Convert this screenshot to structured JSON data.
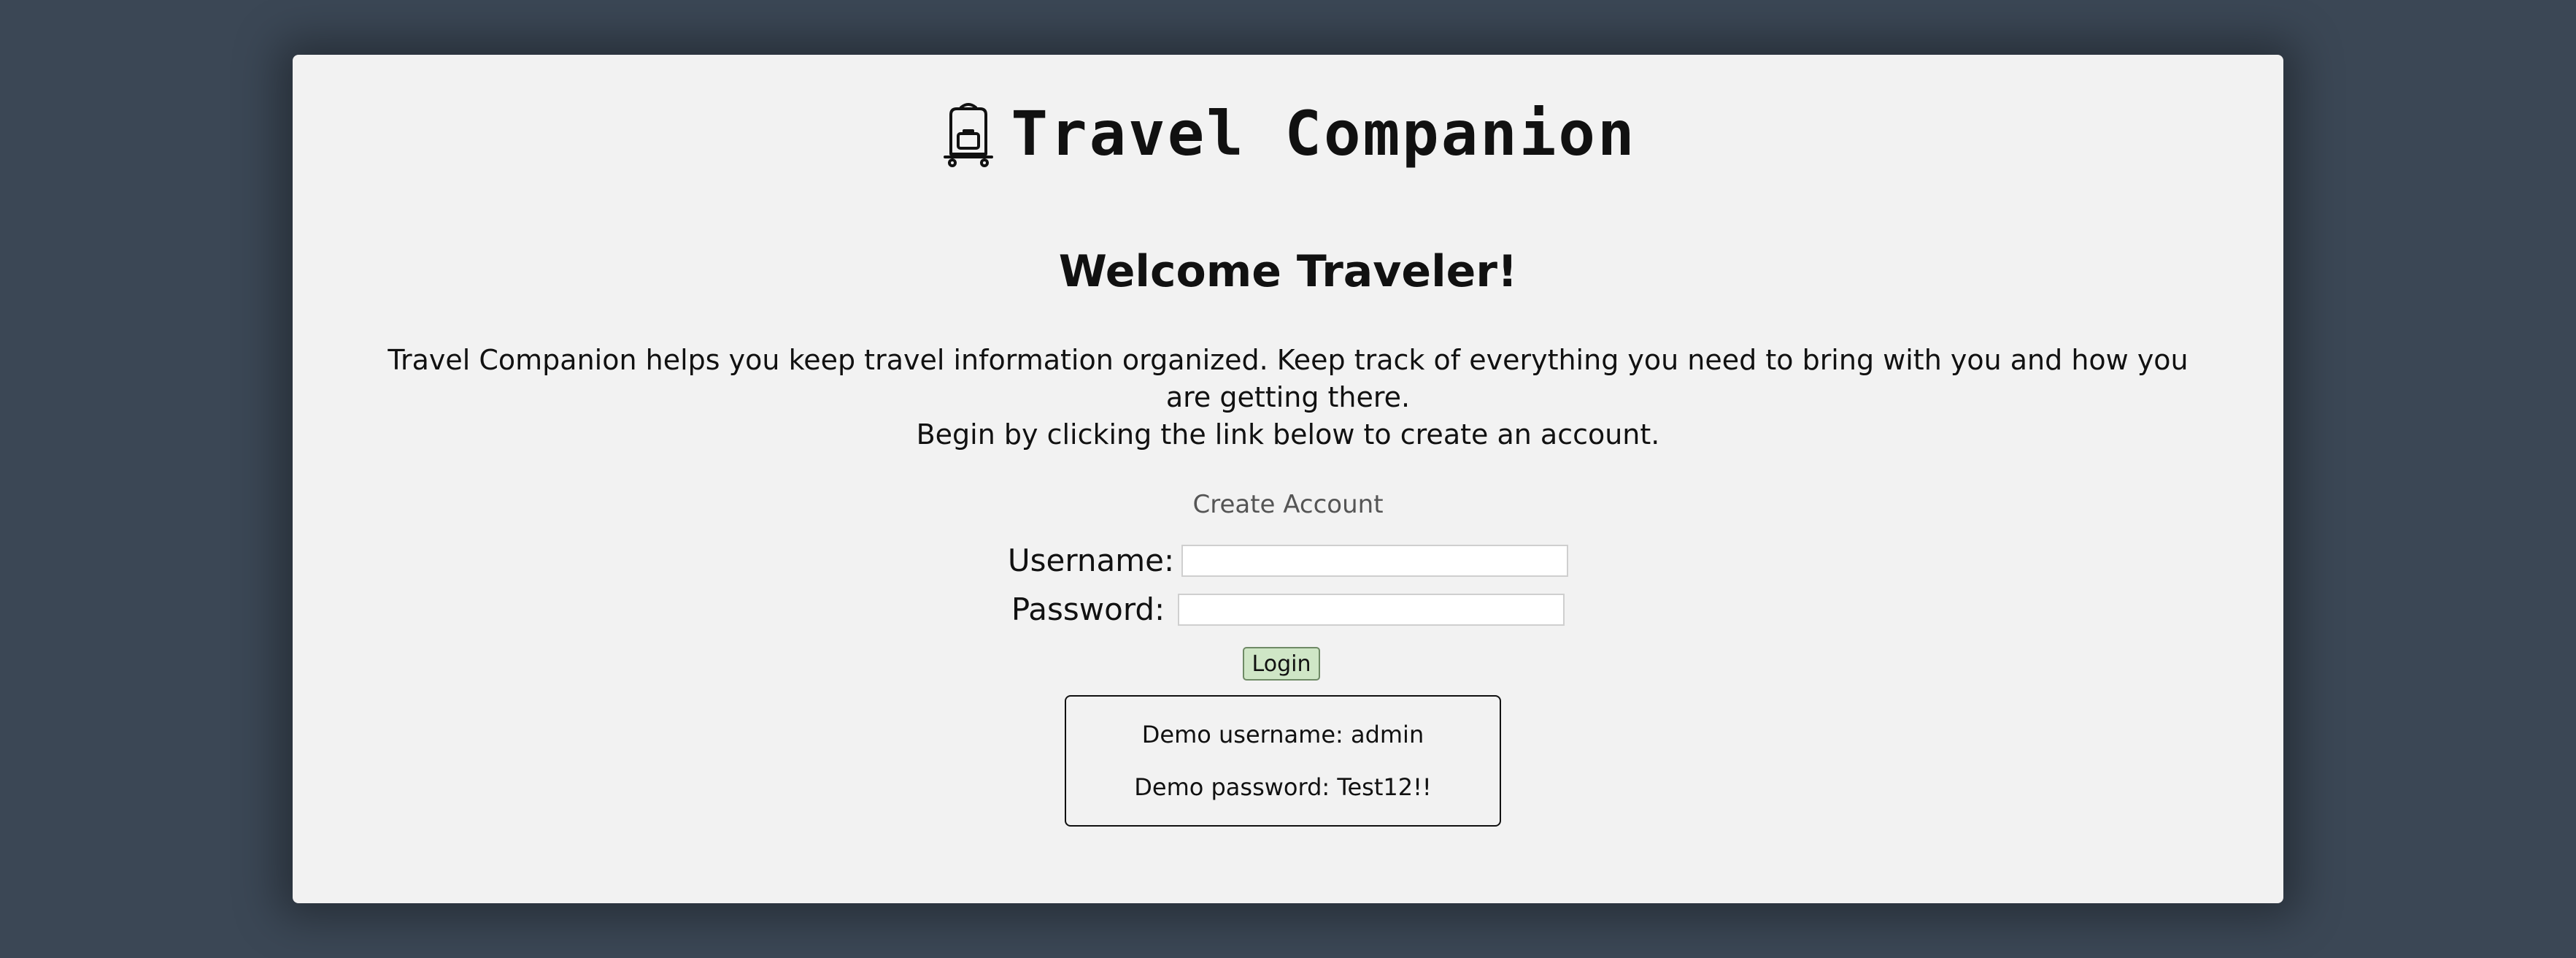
{
  "brand": {
    "title": "Travel Companion",
    "icon": "luggage-cart-icon"
  },
  "welcome": {
    "heading": "Welcome Traveler!",
    "intro_line1": "Travel Companion helps you keep travel information organized. Keep track of everything you need to bring with you and how you are getting there.",
    "intro_line2": "Begin by clicking the link below to create an account."
  },
  "create_account": {
    "label": "Create Account"
  },
  "login_form": {
    "username_label": "Username:",
    "username_value": "",
    "password_label": "Password:",
    "password_value": "",
    "submit_label": "Login"
  },
  "demo": {
    "username_text": "Demo username: admin",
    "password_text": "Demo password: Test12!!"
  },
  "colors": {
    "background": "#3b4755",
    "card": "#f2f2f2",
    "login_button": "#cfe6c6",
    "link": "#555555"
  }
}
